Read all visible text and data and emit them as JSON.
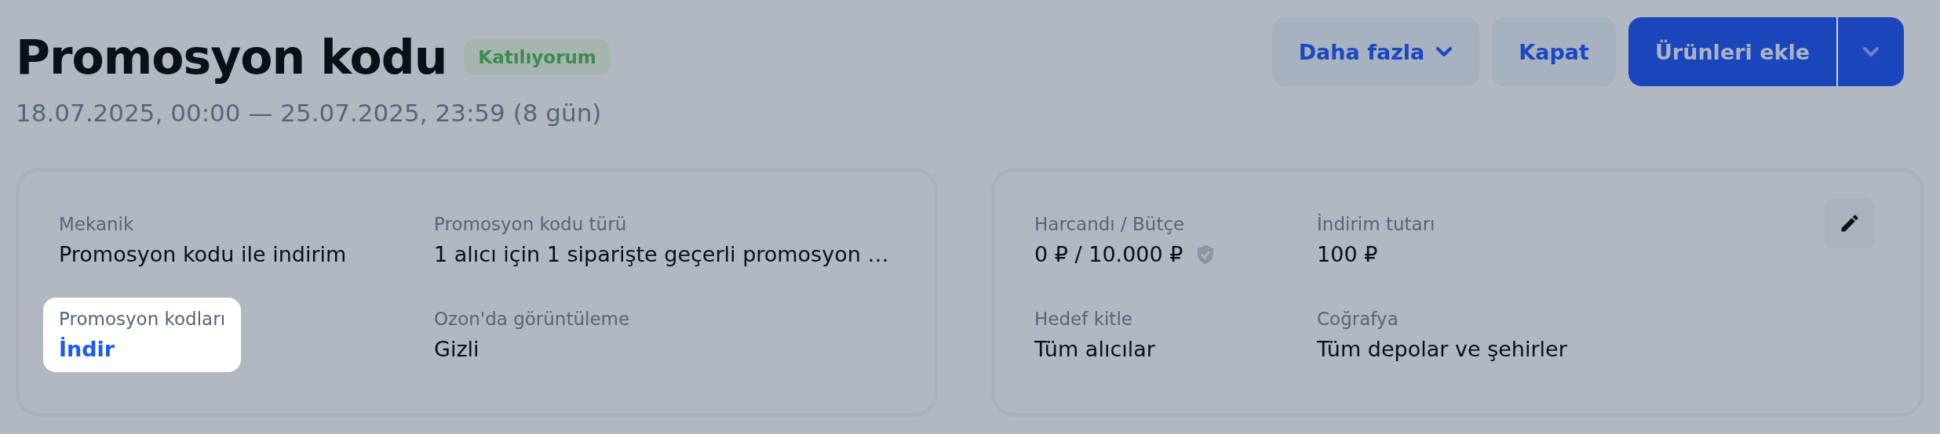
{
  "header": {
    "title": "Promosyon kodu",
    "status": "Katılıyorum",
    "period": "18.07.2025, 00:00 — 25.07.2025, 23:59 (8 gün)"
  },
  "actions": [
    {
      "kind": "menu",
      "label": "Daha fazla"
    },
    {
      "kind": "plain",
      "label": "Kapat"
    },
    {
      "kind": "split",
      "label": "Ürünleri ekle"
    }
  ],
  "cards": [
    {
      "editable": false,
      "fields": [
        {
          "kind": "text",
          "label": "Mekanik",
          "value": "Promosyon kodu ile indirim",
          "highlighted": false
        },
        {
          "kind": "text",
          "label": "Promosyon kodu türü",
          "value": "1 alıcı için 1 siparişte geçerli promosyon …",
          "highlighted": false
        },
        {
          "kind": "link",
          "label": "Promosyon kodları",
          "value": "İndir",
          "highlighted": true
        },
        {
          "kind": "text",
          "label": "Ozon'da görüntüleme",
          "value": "Gizli",
          "highlighted": false
        }
      ]
    },
    {
      "editable": true,
      "fields": [
        {
          "kind": "protected",
          "label": "Harcandı / Bütçe",
          "value": "0 ₽ / 10.000 ₽",
          "highlighted": false
        },
        {
          "kind": "text",
          "label": "İndirim tutarı",
          "value": "100 ₽",
          "highlighted": false
        },
        {
          "kind": "text",
          "label": "Hedef kitle",
          "value": "Tüm alıcılar",
          "highlighted": false
        },
        {
          "kind": "text",
          "label": "Coğrafya",
          "value": "Tüm depolar ve şehirler",
          "highlighted": false
        }
      ]
    }
  ]
}
